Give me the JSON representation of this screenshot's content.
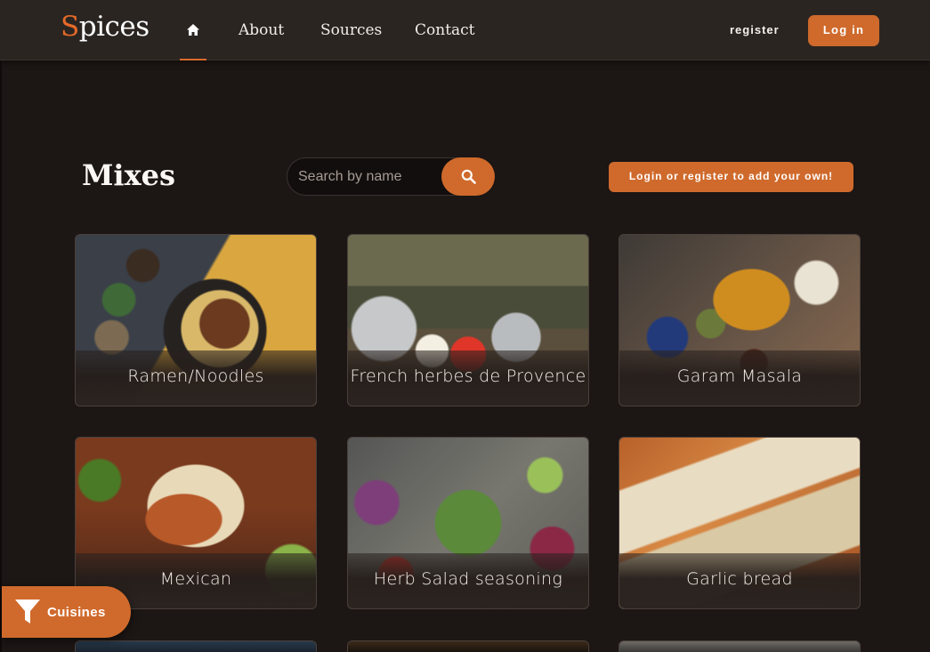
{
  "brand": {
    "logo_first": "S",
    "logo_rest": "pices"
  },
  "nav": {
    "home_icon": "home-icon",
    "links": [
      "About",
      "Sources",
      "Contact"
    ],
    "register": "register",
    "login": "Log in"
  },
  "main": {
    "title": "Mixes",
    "search_placeholder": "Search by name",
    "search_icon": "search-icon",
    "add_button": "Login or register to add your own!"
  },
  "cards": [
    {
      "label": "Ramen/Noodles"
    },
    {
      "label": "French herbes de Provence"
    },
    {
      "label": "Garam Masala"
    },
    {
      "label": "Mexican"
    },
    {
      "label": "Herb Salad seasoning"
    },
    {
      "label": "Garlic bread"
    }
  ],
  "cuisines": {
    "label": "Cuisines",
    "icon": "filter-icon"
  },
  "colors": {
    "accent": "#cf6a2c",
    "background": "#1c1614",
    "navbar": "#2b2522"
  }
}
